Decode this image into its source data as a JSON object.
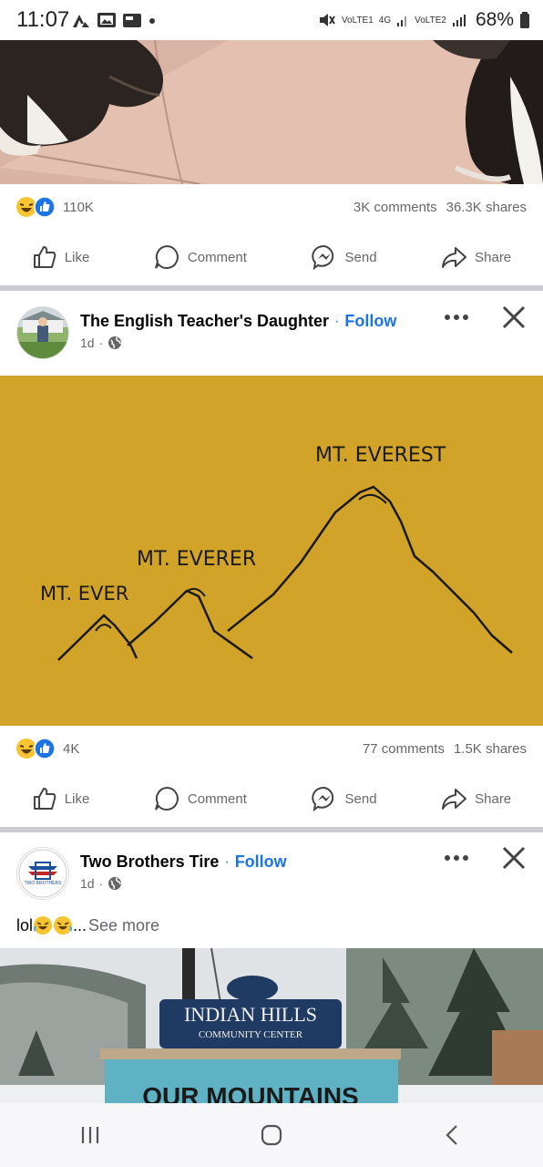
{
  "status_bar": {
    "time": "11:07",
    "network_1": "VoLTE1",
    "network_type": "4G",
    "network_2": "VoLTE2",
    "battery": "68%"
  },
  "posts": [
    {
      "reactions_count": "110K",
      "comments": "3K comments",
      "shares": "36.3K shares",
      "actions": {
        "like": "Like",
        "comment": "Comment",
        "send": "Send",
        "share": "Share"
      }
    },
    {
      "author": "The English Teacher's Daughter",
      "follow": "Follow",
      "time": "1d",
      "image_text": {
        "label1": "MT. EVER",
        "label2": "MT. EVERER",
        "label3": "MT. EVEREST"
      },
      "reactions_count": "4K",
      "comments": "77 comments",
      "shares": "1.5K shares",
      "actions": {
        "like": "Like",
        "comment": "Comment",
        "send": "Send",
        "share": "Share"
      }
    },
    {
      "author": "Two Brothers Tire",
      "follow": "Follow",
      "time": "1d",
      "caption": "lol",
      "caption_ellipsis": "...",
      "see_more": "See more",
      "avatar_text": "TWO BROTHERS",
      "image_text": {
        "sign_line1": "INDIAN HILLS",
        "sign_line2": "COMMUNITY CENTER",
        "marquee": "OUR MOUNTAINS"
      }
    }
  ],
  "colors": {
    "accent": "#1b74e4",
    "muted": "#65676b",
    "divider": "#c9ccd1",
    "mustard": "#d4a62a"
  }
}
